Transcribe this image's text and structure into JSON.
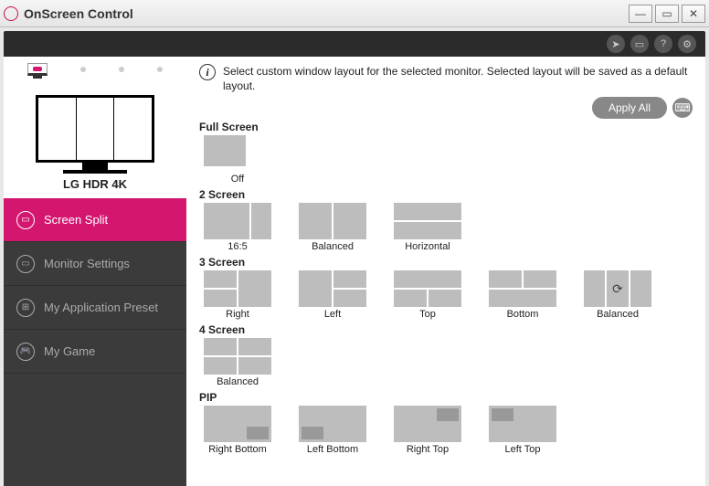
{
  "app": {
    "title": "OnScreen Control"
  },
  "toolbar": {
    "apply_all": "Apply All"
  },
  "info": {
    "text": "Select custom window layout for the selected monitor. Selected layout will be saved as a default layout."
  },
  "monitor": {
    "name": "LG HDR 4K"
  },
  "nav": {
    "screen_split": "Screen Split",
    "monitor_settings": "Monitor Settings",
    "app_preset": "My Application Preset",
    "my_game": "My Game"
  },
  "sections": {
    "full_screen": {
      "title": "Full Screen",
      "items": [
        {
          "label": "Off"
        }
      ]
    },
    "two_screen": {
      "title": "2 Screen",
      "items": [
        {
          "label": "16:5"
        },
        {
          "label": "Balanced"
        },
        {
          "label": "Horizontal"
        }
      ]
    },
    "three_screen": {
      "title": "3 Screen",
      "items": [
        {
          "label": "Right"
        },
        {
          "label": "Left"
        },
        {
          "label": "Top"
        },
        {
          "label": "Bottom"
        },
        {
          "label": "Balanced"
        }
      ]
    },
    "four_screen": {
      "title": "4 Screen",
      "items": [
        {
          "label": "Balanced"
        }
      ]
    },
    "pip": {
      "title": "PIP",
      "items": [
        {
          "label": "Right Bottom"
        },
        {
          "label": "Left Bottom"
        },
        {
          "label": "Right Top"
        },
        {
          "label": "Left Top"
        }
      ]
    }
  }
}
